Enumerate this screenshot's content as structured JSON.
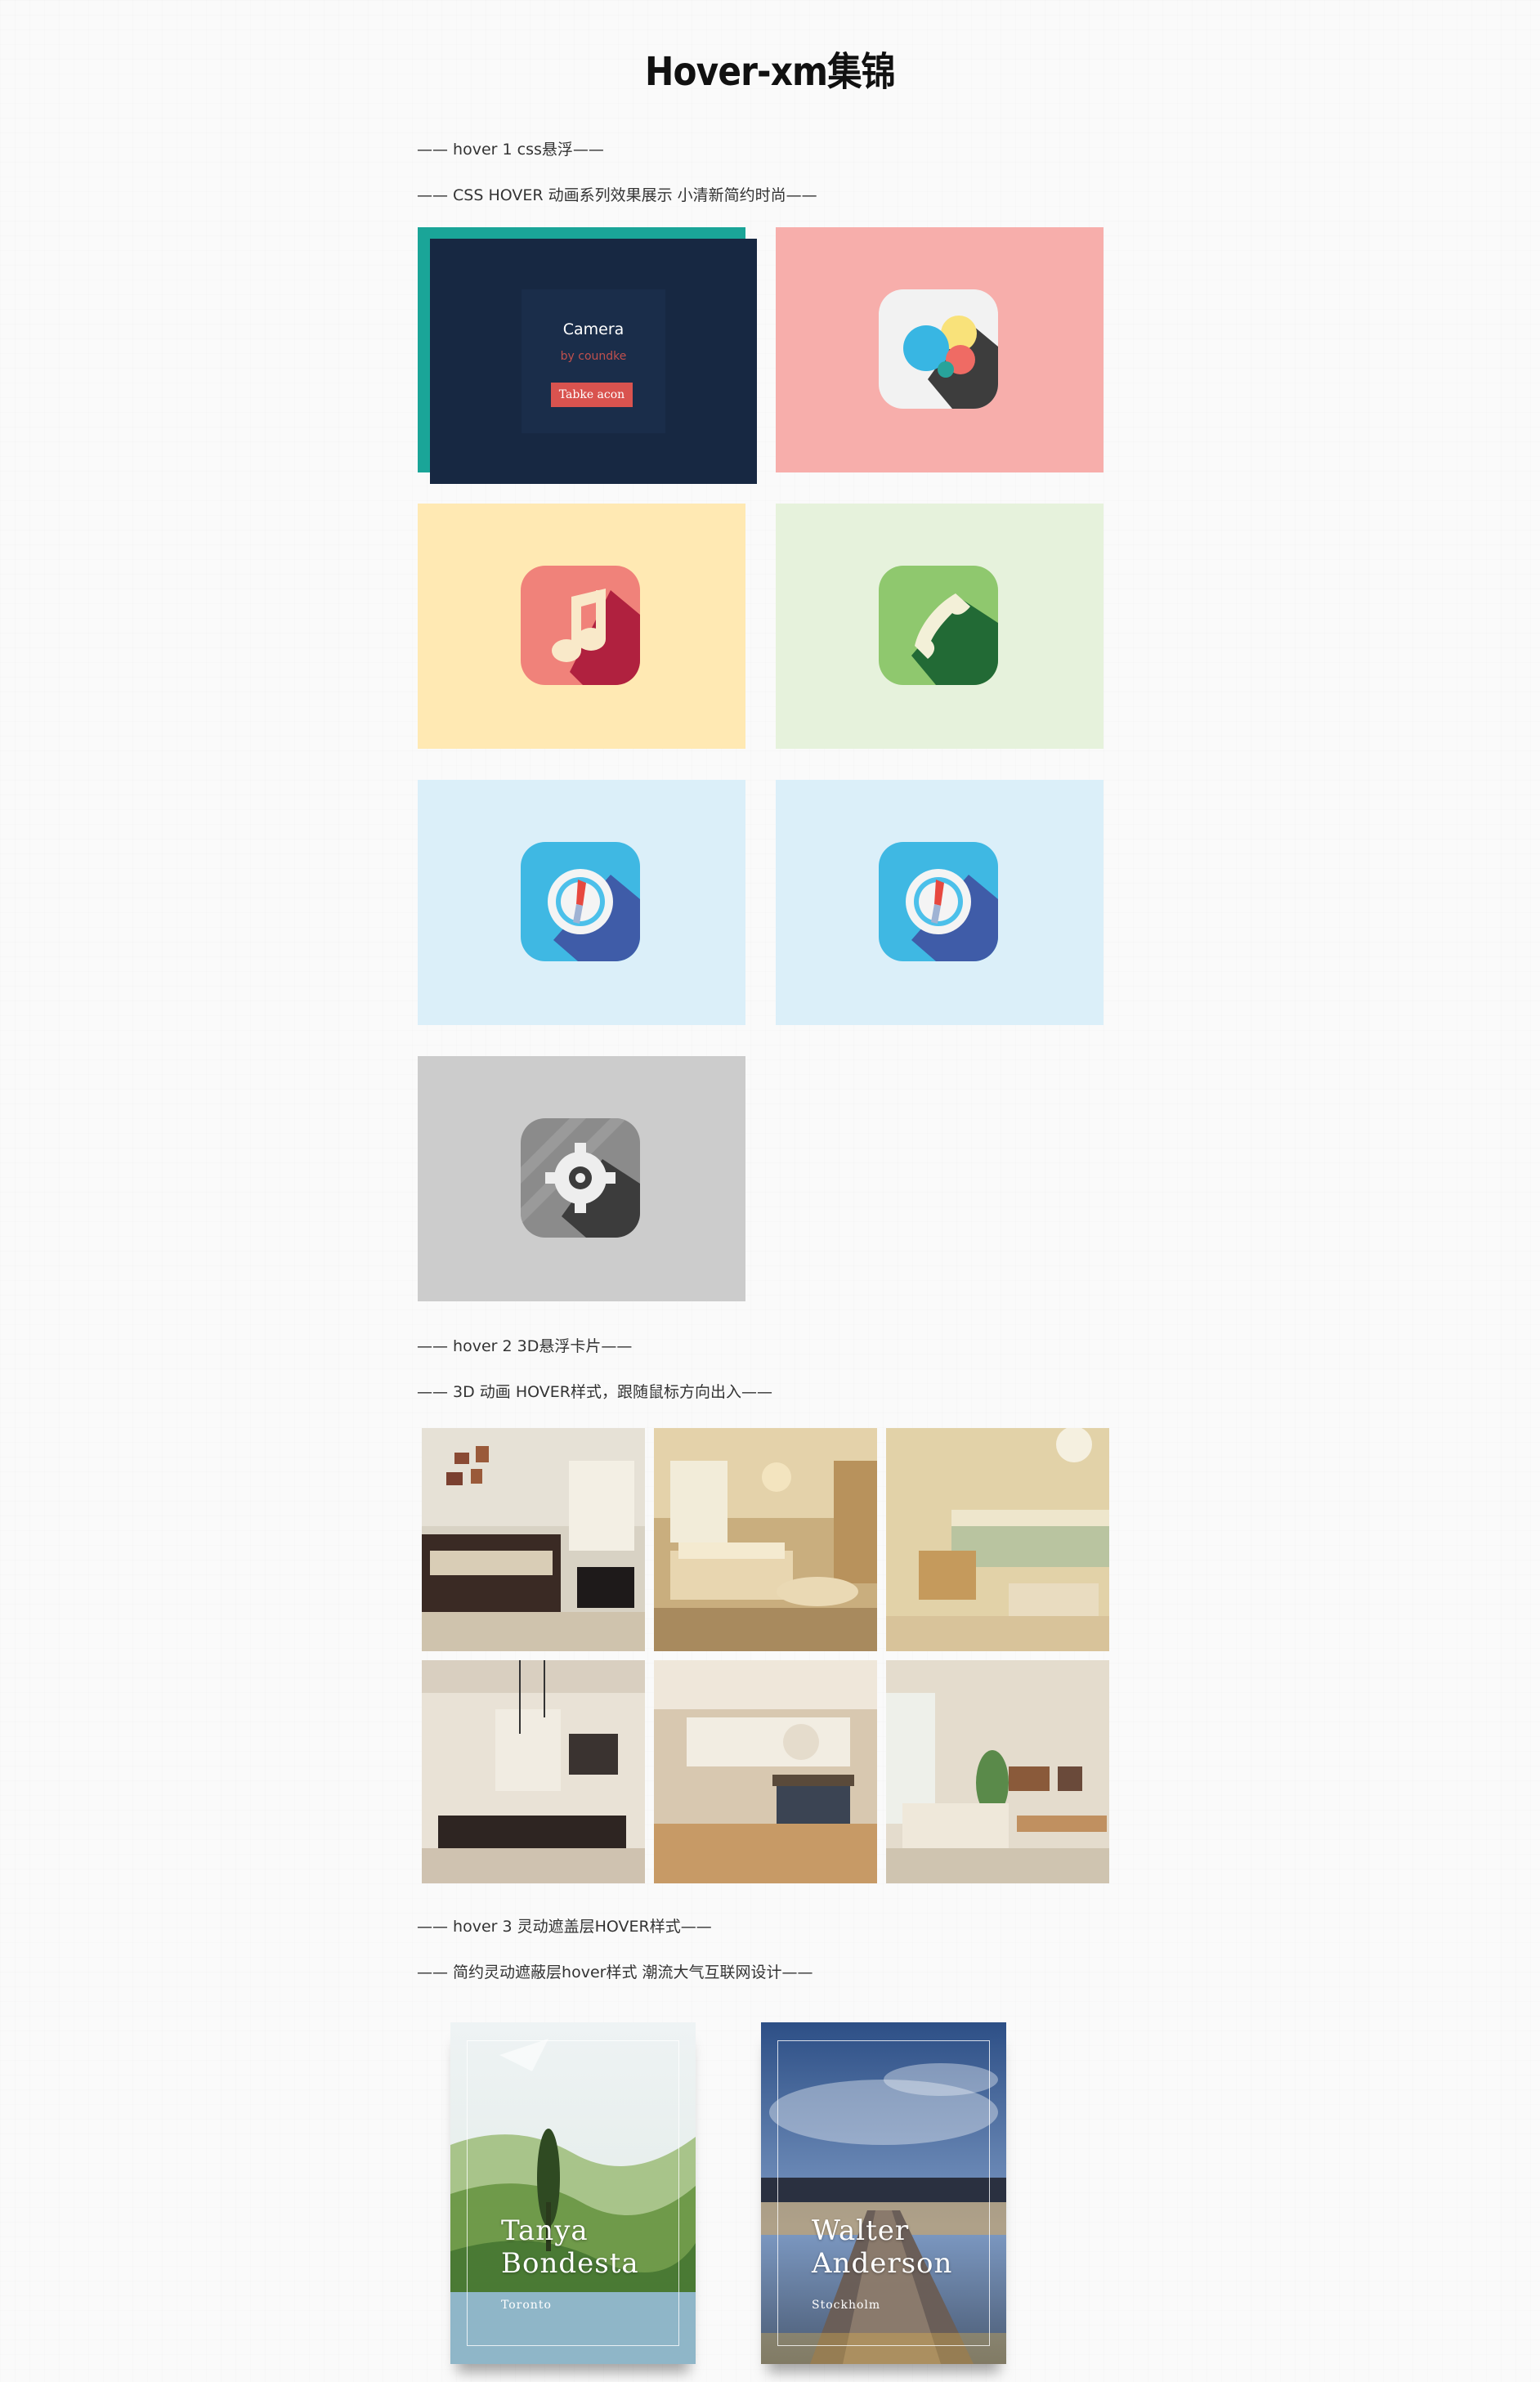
{
  "page": {
    "title": "Hover-xm集锦"
  },
  "section1": {
    "heading": "—— hover 1 css悬浮——",
    "subheading": "—— CSS HOVER 动画系列效果展示 小清新简约时尚——",
    "camera_card": {
      "title": "Camera",
      "byline": "by coundke",
      "button": "Tabke acon"
    },
    "tiles": [
      {
        "icon": "camera-card",
        "bg": "#172842"
      },
      {
        "icon": "bubbles-icon",
        "bg": "#f7aeab"
      },
      {
        "icon": "music-note-icon",
        "bg": "#ffe9b3"
      },
      {
        "icon": "phone-icon",
        "bg": "#e6f2dc"
      },
      {
        "icon": "compass-icon",
        "bg": "#dbeff9"
      },
      {
        "icon": "compass-icon",
        "bg": "#dbeff9"
      },
      {
        "icon": "gear-icon",
        "bg": "#cccccc"
      }
    ]
  },
  "section2": {
    "heading": "—— hover 2 3D悬浮卡片——",
    "subheading": "—— 3D 动画 HOVER样式，跟随鼠标方向出入——",
    "photos": [
      "living-room-1",
      "bedroom",
      "living-room-2",
      "dining-room",
      "kitchen",
      "living-room-3"
    ]
  },
  "section3": {
    "heading": "—— hover 3 灵动遮盖层HOVER样式——",
    "subheading": "—— 简约灵动遮蔽层hover样式 潮流大气互联网设计——",
    "cards": [
      {
        "name_line1": "Tanya",
        "name_line2": "Bondesta",
        "city": "Toronto"
      },
      {
        "name_line1": "Walter",
        "name_line2": "Anderson",
        "city": "Stockholm"
      }
    ]
  }
}
